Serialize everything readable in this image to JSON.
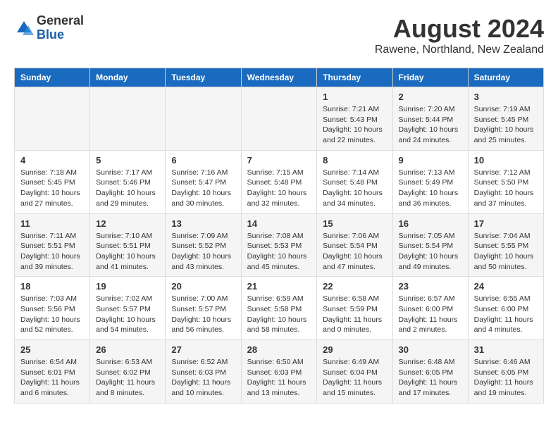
{
  "header": {
    "logo_general": "General",
    "logo_blue": "Blue",
    "main_title": "August 2024",
    "subtitle": "Rawene, Northland, New Zealand"
  },
  "calendar": {
    "days_of_week": [
      "Sunday",
      "Monday",
      "Tuesday",
      "Wednesday",
      "Thursday",
      "Friday",
      "Saturday"
    ],
    "weeks": [
      [
        {
          "day": "",
          "info": ""
        },
        {
          "day": "",
          "info": ""
        },
        {
          "day": "",
          "info": ""
        },
        {
          "day": "",
          "info": ""
        },
        {
          "day": "1",
          "info": "Sunrise: 7:21 AM\nSunset: 5:43 PM\nDaylight: 10 hours and 22 minutes."
        },
        {
          "day": "2",
          "info": "Sunrise: 7:20 AM\nSunset: 5:44 PM\nDaylight: 10 hours and 24 minutes."
        },
        {
          "day": "3",
          "info": "Sunrise: 7:19 AM\nSunset: 5:45 PM\nDaylight: 10 hours and 25 minutes."
        }
      ],
      [
        {
          "day": "4",
          "info": "Sunrise: 7:18 AM\nSunset: 5:45 PM\nDaylight: 10 hours and 27 minutes."
        },
        {
          "day": "5",
          "info": "Sunrise: 7:17 AM\nSunset: 5:46 PM\nDaylight: 10 hours and 29 minutes."
        },
        {
          "day": "6",
          "info": "Sunrise: 7:16 AM\nSunset: 5:47 PM\nDaylight: 10 hours and 30 minutes."
        },
        {
          "day": "7",
          "info": "Sunrise: 7:15 AM\nSunset: 5:48 PM\nDaylight: 10 hours and 32 minutes."
        },
        {
          "day": "8",
          "info": "Sunrise: 7:14 AM\nSunset: 5:48 PM\nDaylight: 10 hours and 34 minutes."
        },
        {
          "day": "9",
          "info": "Sunrise: 7:13 AM\nSunset: 5:49 PM\nDaylight: 10 hours and 36 minutes."
        },
        {
          "day": "10",
          "info": "Sunrise: 7:12 AM\nSunset: 5:50 PM\nDaylight: 10 hours and 37 minutes."
        }
      ],
      [
        {
          "day": "11",
          "info": "Sunrise: 7:11 AM\nSunset: 5:51 PM\nDaylight: 10 hours and 39 minutes."
        },
        {
          "day": "12",
          "info": "Sunrise: 7:10 AM\nSunset: 5:51 PM\nDaylight: 10 hours and 41 minutes."
        },
        {
          "day": "13",
          "info": "Sunrise: 7:09 AM\nSunset: 5:52 PM\nDaylight: 10 hours and 43 minutes."
        },
        {
          "day": "14",
          "info": "Sunrise: 7:08 AM\nSunset: 5:53 PM\nDaylight: 10 hours and 45 minutes."
        },
        {
          "day": "15",
          "info": "Sunrise: 7:06 AM\nSunset: 5:54 PM\nDaylight: 10 hours and 47 minutes."
        },
        {
          "day": "16",
          "info": "Sunrise: 7:05 AM\nSunset: 5:54 PM\nDaylight: 10 hours and 49 minutes."
        },
        {
          "day": "17",
          "info": "Sunrise: 7:04 AM\nSunset: 5:55 PM\nDaylight: 10 hours and 50 minutes."
        }
      ],
      [
        {
          "day": "18",
          "info": "Sunrise: 7:03 AM\nSunset: 5:56 PM\nDaylight: 10 hours and 52 minutes."
        },
        {
          "day": "19",
          "info": "Sunrise: 7:02 AM\nSunset: 5:57 PM\nDaylight: 10 hours and 54 minutes."
        },
        {
          "day": "20",
          "info": "Sunrise: 7:00 AM\nSunset: 5:57 PM\nDaylight: 10 hours and 56 minutes."
        },
        {
          "day": "21",
          "info": "Sunrise: 6:59 AM\nSunset: 5:58 PM\nDaylight: 10 hours and 58 minutes."
        },
        {
          "day": "22",
          "info": "Sunrise: 6:58 AM\nSunset: 5:59 PM\nDaylight: 11 hours and 0 minutes."
        },
        {
          "day": "23",
          "info": "Sunrise: 6:57 AM\nSunset: 6:00 PM\nDaylight: 11 hours and 2 minutes."
        },
        {
          "day": "24",
          "info": "Sunrise: 6:55 AM\nSunset: 6:00 PM\nDaylight: 11 hours and 4 minutes."
        }
      ],
      [
        {
          "day": "25",
          "info": "Sunrise: 6:54 AM\nSunset: 6:01 PM\nDaylight: 11 hours and 6 minutes."
        },
        {
          "day": "26",
          "info": "Sunrise: 6:53 AM\nSunset: 6:02 PM\nDaylight: 11 hours and 8 minutes."
        },
        {
          "day": "27",
          "info": "Sunrise: 6:52 AM\nSunset: 6:03 PM\nDaylight: 11 hours and 10 minutes."
        },
        {
          "day": "28",
          "info": "Sunrise: 6:50 AM\nSunset: 6:03 PM\nDaylight: 11 hours and 13 minutes."
        },
        {
          "day": "29",
          "info": "Sunrise: 6:49 AM\nSunset: 6:04 PM\nDaylight: 11 hours and 15 minutes."
        },
        {
          "day": "30",
          "info": "Sunrise: 6:48 AM\nSunset: 6:05 PM\nDaylight: 11 hours and 17 minutes."
        },
        {
          "day": "31",
          "info": "Sunrise: 6:46 AM\nSunset: 6:05 PM\nDaylight: 11 hours and 19 minutes."
        }
      ]
    ]
  }
}
